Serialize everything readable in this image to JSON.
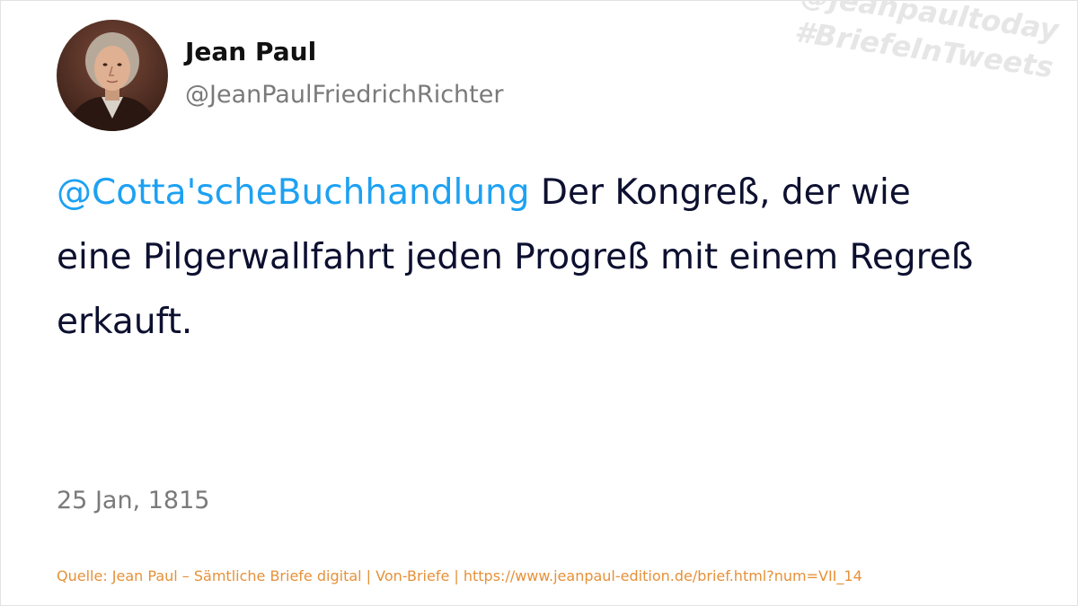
{
  "author": {
    "name": "Jean Paul",
    "handle": "@JeanPaulFriedrichRichter",
    "avatar_icon": "portrait-avatar"
  },
  "watermark": {
    "line1": "@jeanpaultoday",
    "line2": "#BriefeInTweets"
  },
  "tweet": {
    "mention": "@Cotta'scheBuchhandlung",
    "text": " Der Kongreß, der wie eine Pilgerwallfahrt jeden Progreß mit einem Regreß erkauft.",
    "date": "25 Jan, 1815"
  },
  "source": {
    "line": "Quelle: Jean Paul – Sämtliche Briefe digital | Von-Briefe | https://www.jeanpaul-edition.de/brief.html?num=VII_14"
  },
  "colors": {
    "mention": "#1da1f2",
    "text": "#0d1030",
    "muted": "#7a7a7a",
    "source": "#e69138"
  }
}
